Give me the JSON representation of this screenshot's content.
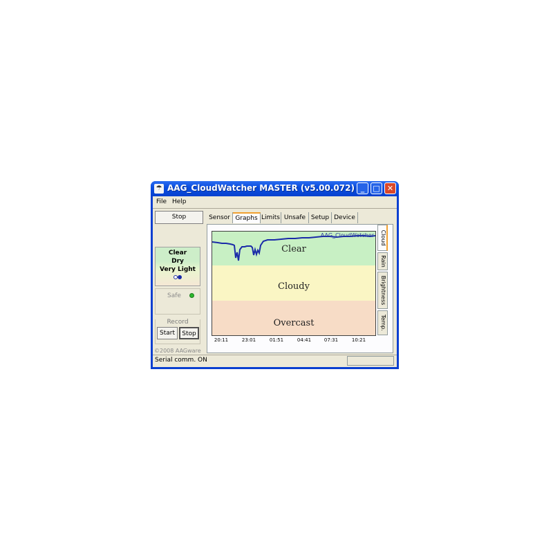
{
  "window": {
    "title": "AAG_CloudWatcher MASTER (v5.00.072)",
    "minimize": "_",
    "maximize": "□",
    "close": "✕"
  },
  "menu": {
    "file": "File",
    "help": "Help"
  },
  "left": {
    "stop_button": "Stop",
    "status": {
      "sky": "Clear",
      "rain": "Dry",
      "light": "Very Light"
    },
    "safe_label": "Safe",
    "record": {
      "title": "Record",
      "start": "Start",
      "stop": "Stop"
    },
    "copyright": "©2008 AAGware"
  },
  "tabs": [
    "Sensor",
    "Graphs",
    "Limits",
    "Unsafe",
    "Setup",
    "Device"
  ],
  "graph": {
    "title": "AAG_CloudWatcher",
    "zones": [
      "Clear",
      "Cloudy",
      "Overcast"
    ],
    "x_ticks": [
      "20:11",
      "23:01",
      "01:51",
      "04:41",
      "07:31",
      "10:21"
    ],
    "side_tabs": [
      "Cloud",
      "Rain",
      "Brightness",
      "Temp."
    ]
  },
  "statusbar": {
    "text": "Serial comm. ON"
  },
  "colors": {
    "clear_band": "#c8f0c4",
    "cloudy_band": "#faf6c4",
    "overcast_band": "#f7dcc6",
    "line": "#1a2aa8",
    "safe_led": "#2cb82c"
  }
}
